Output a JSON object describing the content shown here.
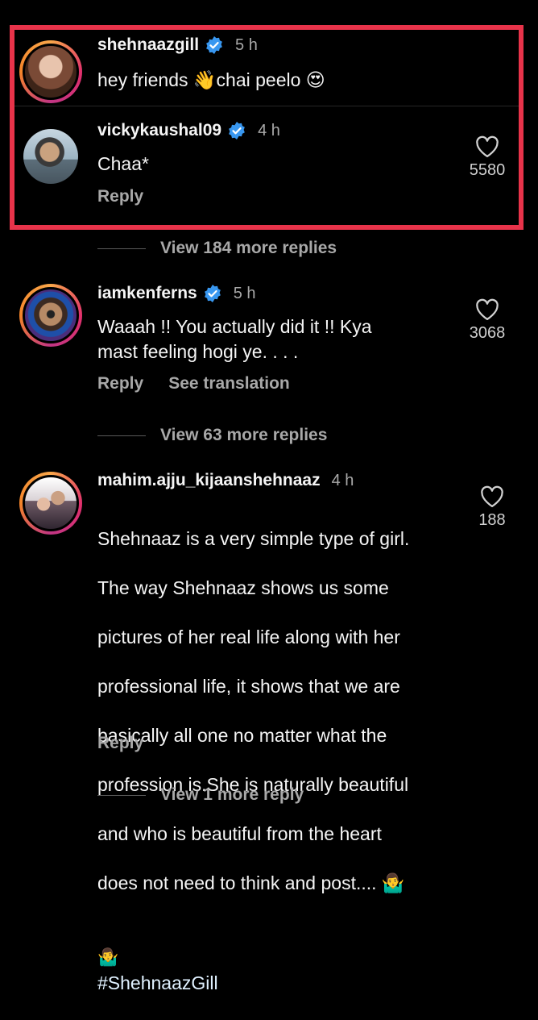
{
  "comments": [
    {
      "username": "shehnaazgill",
      "time": "5 h",
      "text": "hey friends 👋chai peelo 😍",
      "avatar_icon": "woman-avatar"
    },
    {
      "username": "vickykaushal09",
      "time": "4 h",
      "text": "Chaa*",
      "reply_label": "Reply",
      "likes": "5580",
      "avatar_icon": "man-avatar"
    },
    {
      "username": "iamkenferns",
      "time": "5 h",
      "text": "Waaah !! You actually did it !! Kya\nmast feeling hogi ye. . . .",
      "reply_label": "Reply",
      "translate_label": "See translation",
      "likes": "3068",
      "view_more": "View 63 more replies",
      "avatar_icon": "man-sunglasses-avatar"
    },
    {
      "username": "mahim.ajju_kijaanshehnaaz",
      "time": "4 h",
      "text_lines": [
        "Shehnaaz is a very simple type of girl.",
        "The way Shehnaaz shows us some",
        "pictures of her real life along with her",
        "professional life, it shows that we are",
        "basically all one no matter what the",
        "profession is.She is naturally beautiful",
        "and who is beautiful from the heart",
        "does not need to think and post.... 🤷‍♂️"
      ],
      "text_last_emoji": "🤷‍♂️",
      "hashtag": "#ShehnaazGill",
      "reply_label": "Reply",
      "likes": "188",
      "view_more": "View 1 more reply",
      "avatar_icon": "couple-avatar"
    }
  ],
  "thread_view_more": "View 184 more replies",
  "colors": {
    "background": "#000000",
    "highlight_border": "#e8334a",
    "verified": "#3897f0",
    "secondary_text": "#a8a8a8"
  }
}
